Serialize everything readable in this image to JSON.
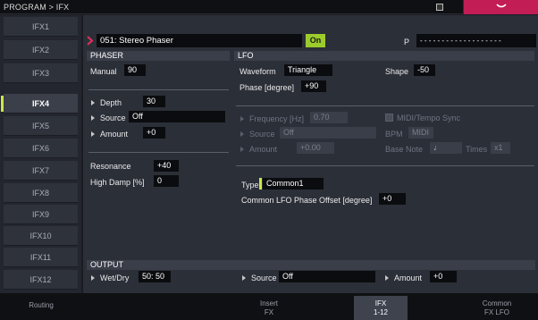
{
  "title_bar": {
    "breadcrumb": "PROGRAM > IFX"
  },
  "sidebar": {
    "tabs": [
      "IFX1",
      "IFX2",
      "IFX3",
      "IFX4",
      "IFX5",
      "IFX6",
      "IFX7",
      "IFX8",
      "IFX9",
      "IFX10",
      "IFX11",
      "IFX12"
    ],
    "active": "IFX4"
  },
  "header": {
    "effect_name": "051: Stereo Phaser",
    "on_label": "On",
    "p_label": "P",
    "p_value": "- - - - - - - - - - - - - - - - - - -"
  },
  "phaser": {
    "section_title": "PHASER",
    "manual_label": "Manual",
    "manual_value": "90",
    "depth_label": "Depth",
    "depth_value": "30",
    "source_label": "Source",
    "source_value": "Off",
    "amount_label": "Amount",
    "amount_value": "+0",
    "resonance_label": "Resonance",
    "resonance_value": "+40",
    "high_damp_label": "High Damp [%]",
    "high_damp_value": "0"
  },
  "lfo": {
    "section_title": "LFO",
    "waveform_label": "Waveform",
    "waveform_value": "Triangle",
    "shape_label": "Shape",
    "shape_value": "-50",
    "phase_label": "Phase [degree]",
    "phase_value": "+90",
    "frequency_label": "Frequency [Hz]",
    "frequency_value": "0.70",
    "source_label": "Source",
    "source_value": "Off",
    "amount_label": "Amount",
    "amount_value": "+0.00",
    "midi_sync_label": "MIDI/Tempo Sync",
    "bpm_label": "BPM",
    "bpm_value": "MIDI",
    "base_note_label": "Base Note",
    "base_note_value": "♩",
    "times_label": "Times",
    "times_value": "x1",
    "type_label": "Type",
    "type_value": "Common1",
    "common_offset_label": "Common LFO Phase Offset [degree]",
    "common_offset_value": "+0"
  },
  "output": {
    "section_title": "OUTPUT",
    "wetdry_label": "Wet/Dry",
    "wetdry_value": "50: 50",
    "source_label": "Source",
    "source_value": "Off",
    "amount_label": "Amount",
    "amount_value": "+0"
  },
  "bottom_tabs": [
    {
      "line1": "Routing",
      "line2": ""
    },
    {
      "line1": "Insert",
      "line2": "FX"
    },
    {
      "line1": "IFX",
      "line2": "1-12"
    },
    {
      "line1": "Common",
      "line2": "FX LFO"
    }
  ],
  "colors": {
    "accent_green": "#cde64a",
    "on_button": "#9ccc2c",
    "menu_magenta": "#c21d55",
    "header_arrow": "#e0305f"
  },
  "icons": {
    "header": "arrow-right-icon",
    "title_menu": "chevron-down-icon",
    "title_mini": "page-icon"
  }
}
